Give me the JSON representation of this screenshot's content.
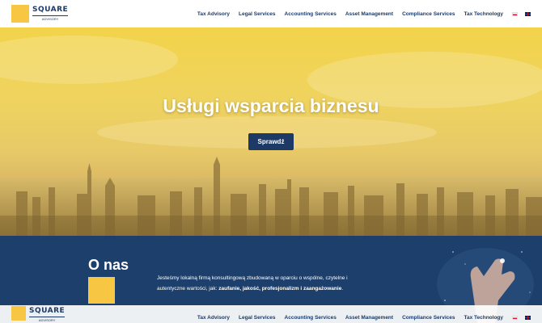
{
  "brand": {
    "name": "SQUARE",
    "tagline": "ADVISORY"
  },
  "nav": {
    "items": [
      {
        "label": "Tax Advisory"
      },
      {
        "label": "Legal Services"
      },
      {
        "label": "Accounting Services"
      },
      {
        "label": "Asset Management"
      },
      {
        "label": "Compliance Services"
      },
      {
        "label": "Tax Technology"
      }
    ],
    "languages": [
      "pl-flag-icon",
      "en-flag-icon"
    ]
  },
  "hero": {
    "title": "Usługi wsparcia biznesu",
    "button_label": "Sprawdź"
  },
  "about": {
    "title": "O nas",
    "text_before": "Jesteśmy lokalną firmą konsultingową zbudowaną w oparciu o wspólne, czytelne i autentyczne wartości, jak: ",
    "text_bold": "zaufanie, jakość, profesjonalizm i zaangażowanie",
    "text_after": "."
  },
  "colors": {
    "navy": "#1d3a66",
    "accent": "#f7c744",
    "hero_tint": "#efd35f"
  }
}
